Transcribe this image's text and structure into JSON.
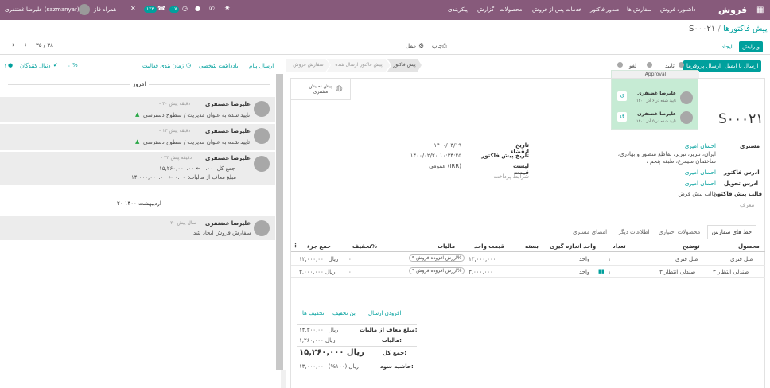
{
  "colors": {
    "brand": "#875a7b",
    "accent": "#00a09d",
    "approval_bg": "#c6ebd4"
  },
  "topbar": {
    "app_title": "فروش",
    "menu": [
      "داشبورد فروش",
      "سفارش ها",
      "صدور فاکتور",
      "خدمات پس از فروش",
      "محصولات",
      "گزارش",
      "پیکربندی"
    ],
    "user": "علیرضا غضنفری (sazmanyar)",
    "company": "همراه فاز",
    "badge_activities": "۱۲۳",
    "badge_messages": "۱۷"
  },
  "breadcrumb": {
    "parent": "پیش فاکتورها",
    "sep": "/",
    "current": "S۰۰۰۲۱"
  },
  "actions": {
    "edit": "ویرایش",
    "create": "ایجاد",
    "print": "چاپ",
    "action": "عمل"
  },
  "pager": {
    "value": "۳۵ / ۳۸"
  },
  "statusbar": {
    "buttons": [
      "ارسال با ایمیل",
      "ارسال پروفرما",
      "تایید",
      "لغو"
    ],
    "stages": [
      "پیش فاکتور",
      "پیش فاکتور ارسال شده",
      "سفارش فروش"
    ]
  },
  "approval": {
    "title": "Approval",
    "entries": [
      {
        "name": "علیرضا غضنفری",
        "status": "تایید شده در ۶ آذر ۱۴۰۱"
      },
      {
        "name": "علیرضا غضنفری",
        "status": "تایید شده در ۵ آذر ۱۴۰۱"
      }
    ]
  },
  "preview": {
    "label": "پیش نمایش مشتری"
  },
  "doc": {
    "number": "S۰۰۰۲۱",
    "fields_right": [
      {
        "label": "مشتری",
        "value": "احسان امیری",
        "sub": "ایران، تبریز، تبریز، تقاطع منصور و بهادری، ساختمان سیمرغ، طبقه پنجم ،"
      },
      {
        "label": "آدرس فاکتور",
        "value": "احسان امیری"
      },
      {
        "label": "آدرس تحویل",
        "value": "احسان امیری"
      },
      {
        "label": "قالب پیش فاکتور",
        "value": "قالب پیش فرض"
      },
      {
        "label": "معرف",
        "value": ""
      }
    ],
    "fields_left": [
      {
        "label": "تاریخ انقضاء",
        "value": "۱۴۰۰/۰۳/۱۹"
      },
      {
        "label": "تاریخ پیش فاکتور",
        "value": "۱۴۰۰/۰۲/۲۰ ۱۰:۳۴:۴۵"
      },
      {
        "label": "لیست قیمت",
        "value": "عمومی (IRR)"
      },
      {
        "label": "شرایط پرداخت",
        "value": ""
      }
    ]
  },
  "tabs": [
    "خط های سفارش",
    "محصولات اختیاری",
    "اطلاعات دیگر",
    "امضای مشتری"
  ],
  "table": {
    "headers": [
      "محصول",
      "توضیح",
      "تعداد",
      "واحد اندازه گیری",
      "بسته",
      "قیمت واحد",
      "مالیات",
      "تخفیف%",
      "جمع جزء"
    ],
    "rows": [
      {
        "product": "مبل فنری",
        "desc": "مبل فنری",
        "qty": "۱",
        "uom": "واحد",
        "unit": "۱۲,۰۰۰,۰۰۰",
        "tax": "ارزش افزوده فروش ۹%",
        "disc": "۰",
        "subtotal": "۱۲,۰۰۰,۰۰۰ ریال"
      },
      {
        "product": "صندلی انتظار ۳",
        "desc": "صندلی انتظار ۳",
        "qty": "۱",
        "uom": "واحد",
        "unit": "۳,۰۰۰,۰۰۰",
        "tax": "ارزش افزوده فروش ۹%",
        "disc": "۰",
        "subtotal": "۳,۰۰۰,۰۰۰ ریال"
      }
    ]
  },
  "footer_links": [
    "افزودن ارسال",
    "بن تخفیف",
    "تخفیف ها"
  ],
  "totals": [
    {
      "label": "مبلغ معاف از مالیات:",
      "value": "۱۴,۳۰۰,۰۰۰ ریال"
    },
    {
      "label": "مالیات:",
      "value": "۱,۲۶۰,۰۰۰ ریال"
    },
    {
      "label": "جمع کل:",
      "value": "۱۵,۲۶۰,۰۰۰ ریال"
    },
    {
      "label": "حاشیه سود:",
      "value": "۱۳,۰۰۰,۰۰۰ ریال (۱۰۰%)"
    }
  ],
  "chatter": {
    "buttons": [
      "ارسال پیام",
      "یادداشت شخصی",
      "زمان بندی فعالیت"
    ],
    "followers": "دنبال کنندگان",
    "follower_count": "۱",
    "paperclip": "۰",
    "sep_today": "امروز",
    "sep_date": "۲۰ اردیبهشت ۱۴۰۰",
    "messages": [
      {
        "author": "علیرضا غضنفری",
        "time": "- ۳۰ دقیقه پیش",
        "body": "تایید شده به عنوان مدیریت / سطوح دسترسی"
      },
      {
        "author": "علیرضا غضنفری",
        "time": "- ۱۳ دقیقه پیش",
        "body": "تایید شده به عنوان مدیریت / سطوح دسترسی"
      },
      {
        "author": "علیرضا غضنفری",
        "time": "- ۳۲ دقیقه پیش",
        "lines": [
          "جمع کل: ۰.۰۰ ← ۱۵,۲۶۰,۰۰۰.۰۰",
          "مبلغ معاف از مالیات: ۰.۰۰ ← ۱۴,۰۰۰,۰۰۰.۰۰"
        ]
      },
      {
        "author": "علیرضا غضنفری",
        "time": "- ۲۰ سال پیش",
        "body": "سفارش فروش ایجاد شد"
      }
    ]
  }
}
